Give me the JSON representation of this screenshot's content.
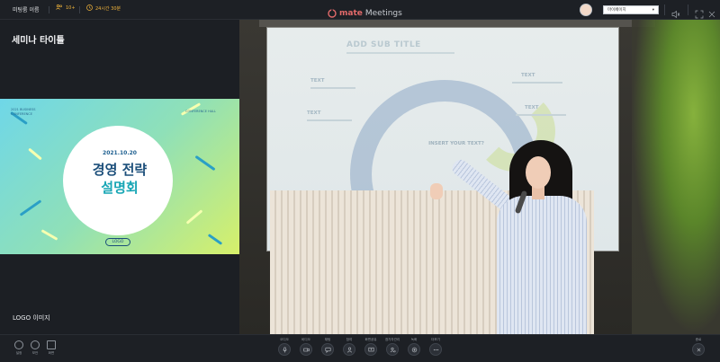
{
  "topbar": {
    "meeting_name": "미팅룸 이름",
    "participants": "10+",
    "time": "24시간 30분",
    "brand": "mate",
    "brand_sub": "Meetings",
    "user_menu": "마이페이지"
  },
  "left": {
    "seminar_title": "세미나 타이틀",
    "logo_image": "LOGO 이미지"
  },
  "slide": {
    "date": "2021.10.20",
    "line1": "경영 전략",
    "line2": "설명회",
    "logo": "LOGO",
    "corner_left": "2021 BUSINESS CONFERENCE",
    "corner_right": "CONFERENCE HALL"
  },
  "projection": {
    "title": "ADD SUB TITLE",
    "label": "TEXT",
    "center": "INSERT YOUR TEXT?"
  },
  "bottombar": {
    "left": [
      {
        "label": "설정",
        "icon": "gear-icon"
      },
      {
        "label": "보안",
        "icon": "shield-icon"
      },
      {
        "label": "화면",
        "icon": "grid-icon"
      }
    ],
    "center": [
      {
        "label": "오디오",
        "icon": "microphone-icon"
      },
      {
        "label": "비디오",
        "icon": "camera-icon"
      },
      {
        "label": "채팅",
        "icon": "chat-icon"
      },
      {
        "label": "참여",
        "icon": "participants-icon"
      },
      {
        "label": "화면공유",
        "icon": "share-screen-icon"
      },
      {
        "label": "참가자관리",
        "icon": "manage-icon"
      },
      {
        "label": "녹화",
        "icon": "record-icon"
      },
      {
        "label": "더보기",
        "icon": "more-icon"
      }
    ],
    "exit_label": "종료"
  },
  "colors": {
    "accent": "#f0b33b",
    "brand": "#e26a6a",
    "bar_bg": "#1d2025"
  }
}
